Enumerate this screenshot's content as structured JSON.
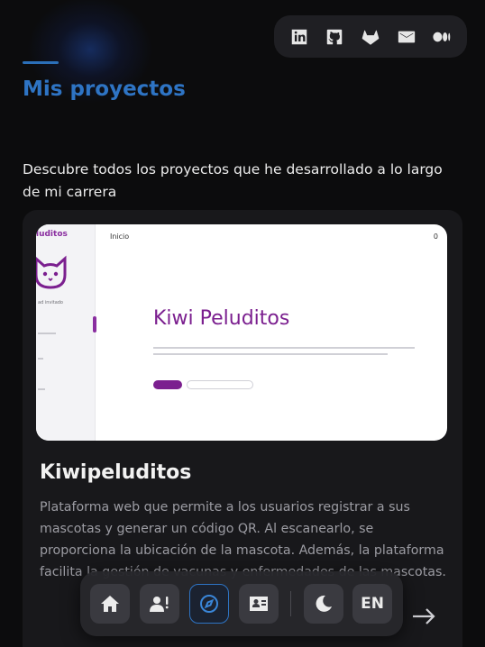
{
  "social": {
    "items": [
      {
        "name": "linkedin-icon"
      },
      {
        "name": "github-icon"
      },
      {
        "name": "gitlab-icon"
      },
      {
        "name": "mail-icon"
      },
      {
        "name": "medium-icon"
      }
    ]
  },
  "section": {
    "title": "Mis proyectos",
    "subtitle": "Descubre todos los proyectos que he desarrollado a lo largo de mi carrera"
  },
  "project": {
    "name": "Kiwipeluditos",
    "description": "Plataforma web que permite a los usuarios registrar a sus mascotas y generar un código QR. Al escanearlo, se proporciona la ubicación de la mascota. Además, la plataforma facilita la gestión de vacunas y enfermedades de las mascotas.",
    "screenshot": {
      "brand": "luditos",
      "nav_label": "Inicio",
      "app_title": "Kiwi Peluditos",
      "side_user": "ad invitado",
      "corner": "0"
    }
  },
  "nav": {
    "language": "EN",
    "items": [
      "home-icon",
      "about-icon",
      "projects-compass-icon",
      "contact-card-icon",
      "dark-mode-icon",
      "language-button"
    ]
  },
  "colors": {
    "accent": "#2e74c4",
    "background": "#0c0c0d",
    "brand_purple": "#7b1f8f"
  }
}
